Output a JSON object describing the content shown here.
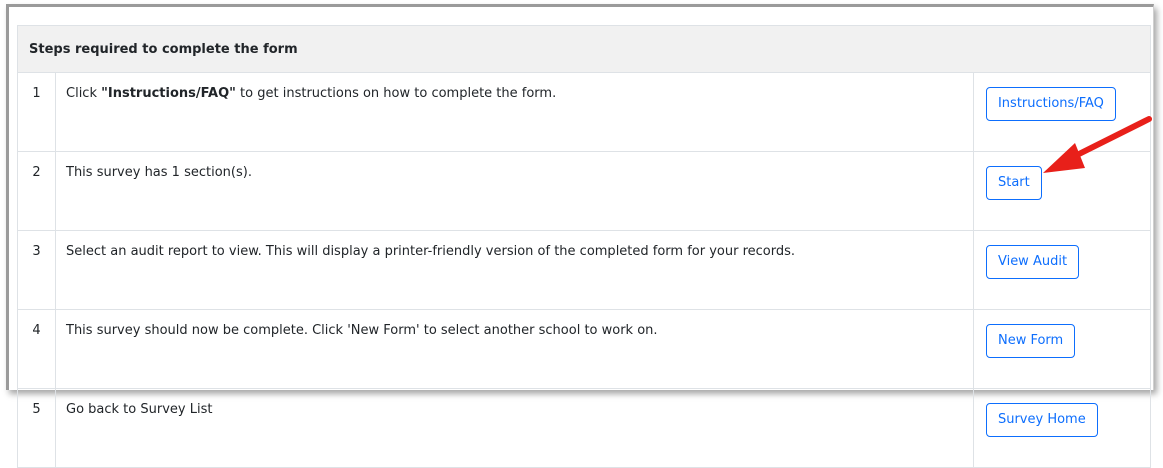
{
  "table": {
    "title": "Steps required to complete the form",
    "rows": [
      {
        "num": "1",
        "pre": "Click ",
        "bold": "\"Instructions/FAQ\"",
        "post": " to get instructions on how to complete the form.",
        "button": "Instructions/FAQ"
      },
      {
        "num": "2",
        "text": "This survey has 1 section(s).",
        "button": "Start"
      },
      {
        "num": "3",
        "text": "Select an audit report to view. This will display a printer-friendly version of the completed form for your records.",
        "button": "View Audit"
      },
      {
        "num": "4",
        "text": "This survey should now be complete. Click 'New Form' to select another school to work on.",
        "button": "New Form"
      },
      {
        "num": "5",
        "text": "Go back to Survey List",
        "button": "Survey Home"
      }
    ]
  },
  "colors": {
    "accent": "#0d6efd",
    "header_bg": "#f1f1f1",
    "border": "#dee2e6",
    "annotation_arrow": "#e8201a"
  },
  "annotation": {
    "icon": "red-arrow-icon"
  }
}
